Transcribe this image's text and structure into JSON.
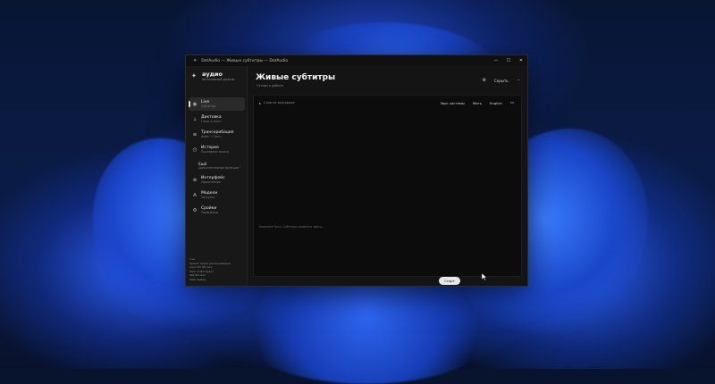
{
  "window": {
    "title": "DotAudio — Живые субтитры — DotAudio",
    "app_glyph": "✦",
    "controls": [
      "—",
      "☐",
      "✕"
    ]
  },
  "brand": {
    "name": "аудио",
    "sub": "автономный режим"
  },
  "sidebar": {
    "items": [
      {
        "icon": "◉",
        "label": "Live",
        "sub": "Субтитры"
      },
      {
        "icon": "⇣",
        "label": "Диктовка",
        "sub": "Голос в текст"
      },
      {
        "icon": "≡",
        "label": "Транскрибация",
        "sub": "Файл → Текст"
      },
      {
        "icon": "◷",
        "label": "История",
        "sub": "Последние записи"
      },
      {
        "icon": "",
        "label": "Ещё",
        "sub": "Дополнительные функции"
      },
      {
        "icon": "⊕",
        "label": "Интерфейс",
        "sub": "Оформление"
      },
      {
        "icon": "A",
        "label": "Модели",
        "sub": "Загрузка"
      },
      {
        "icon": "⚙",
        "label": "Сройки",
        "sub": "Параметры"
      }
    ],
    "footer": [
      "Live",
      "Speech Space распознавание",
      "Live=RU ЖС вкл",
      "Web UI ЖС будет",
      "ЖБ ЖС вкл",
      "Фиш вывод"
    ]
  },
  "header": {
    "title": "Живые субтитры",
    "subtitle": "Готово к работе",
    "settings_icon": "⚙",
    "hide_label": "Скрыть",
    "collapse_icon": "⌃"
  },
  "panel": {
    "cursor_label": "Слов на звукороде",
    "buttons": {
      "source": "Звук системы",
      "mic": "Мить",
      "language": "English"
    },
    "monitor_icon": "▭",
    "placeholder": "Нажмите Пуск. Субтитры появятся здесь..."
  },
  "start_button": "Старт",
  "colors": {
    "window_bg": "#141414",
    "sidebar_bg": "#181818",
    "panel_bg": "#0c0c0c",
    "desktop_accent": "#1f4fd9"
  }
}
